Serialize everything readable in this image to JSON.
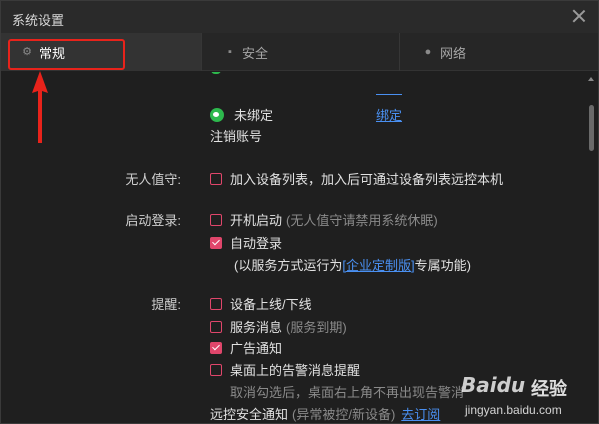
{
  "window": {
    "title": "系统设置"
  },
  "tabs": [
    {
      "label": "常规",
      "icon": "gear-icon"
    },
    {
      "label": "安全",
      "icon": "security-icon"
    },
    {
      "label": "网络",
      "icon": "network-icon"
    }
  ],
  "colors": {
    "accent": "#e0466b",
    "link": "#4a90f2",
    "annotation": "#e8231b"
  },
  "account": {
    "wechat_status": "未绑定",
    "bind_link": "绑定",
    "logout": "注销账号"
  },
  "unattended": {
    "label": "无人值守:",
    "add_device": {
      "text": "加入设备列表，加入后可通过设备列表远控本机",
      "checked": false
    }
  },
  "startup": {
    "label": "启动登录:",
    "boot": {
      "text": "开机启动",
      "note": "(无人值守请禁用系统休眠)",
      "checked": false
    },
    "autologin": {
      "text": "自动登录",
      "checked": true
    },
    "service_note_prefix": "(以服务方式运行为",
    "service_link": "[企业定制版]",
    "service_note_suffix": "专属功能)"
  },
  "remind": {
    "label": "提醒:",
    "items": [
      {
        "text": "设备上线/下线",
        "note": "",
        "checked": false
      },
      {
        "text": "服务消息",
        "note": "(服务到期)",
        "checked": false
      },
      {
        "text": "广告通知",
        "note": "",
        "checked": true
      },
      {
        "text": "桌面上的告警消息提醒",
        "note": "",
        "checked": false
      }
    ],
    "desktop_note": "取消勾选后，桌面右上角不再出现告警消"
  },
  "security_notice": {
    "text": "远控安全通知",
    "note": "(异常被控/新设备)",
    "link": "去订阅"
  },
  "watermark": {
    "logo": "Baidu",
    "text": "经验",
    "url": "jingyan.baidu.com"
  }
}
